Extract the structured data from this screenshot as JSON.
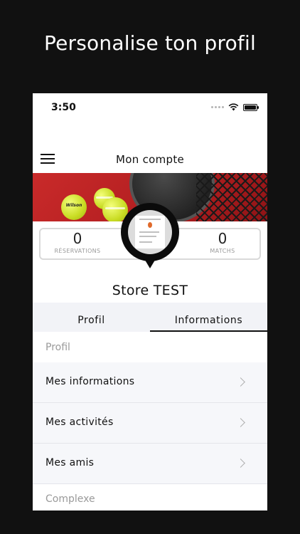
{
  "promo": {
    "title": "Personalise ton profil"
  },
  "status_bar": {
    "time": "3:50"
  },
  "nav": {
    "title": "Mon compte"
  },
  "banner": {
    "ball_brand": "Wilson"
  },
  "stats": {
    "reservations": {
      "value": "0",
      "label": "RÉSERVATIONS"
    },
    "matchs": {
      "value": "0",
      "label": "MATCHS"
    }
  },
  "profile": {
    "name": "Store TEST"
  },
  "tabs": [
    {
      "label": "Profil",
      "active": false
    },
    {
      "label": "Informations",
      "active": true
    }
  ],
  "sections": {
    "profil_header": "Profil",
    "complexe_header": "Complexe"
  },
  "list_items": [
    {
      "label": "Mes informations"
    },
    {
      "label": "Mes activités"
    },
    {
      "label": "Mes amis"
    }
  ],
  "colors": {
    "background": "#111111",
    "banner_red": "#c92a2a",
    "ball_yellow": "#d4e62b"
  }
}
